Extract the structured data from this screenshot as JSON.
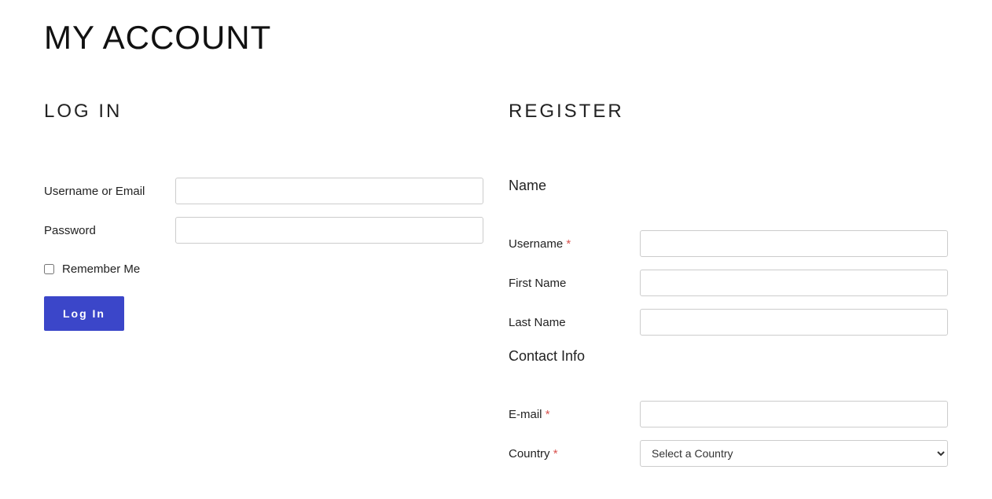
{
  "page": {
    "title": "MY ACCOUNT"
  },
  "login": {
    "heading": "LOG IN",
    "fields": {
      "username_label": "Username or Email",
      "username_value": "",
      "password_label": "Password",
      "password_value": "",
      "remember_label": "Remember Me"
    },
    "submit_label": "Log In"
  },
  "register": {
    "heading": "REGISTER",
    "section_name": "Name",
    "section_contact": "Contact Info",
    "fields": {
      "username_label": "Username",
      "username_required": "*",
      "username_value": "",
      "firstname_label": "First Name",
      "firstname_value": "",
      "lastname_label": "Last Name",
      "lastname_value": "",
      "email_label": "E-mail",
      "email_required": "*",
      "email_value": "",
      "country_label": "Country",
      "country_required": "*",
      "country_placeholder": "Select a Country"
    }
  }
}
